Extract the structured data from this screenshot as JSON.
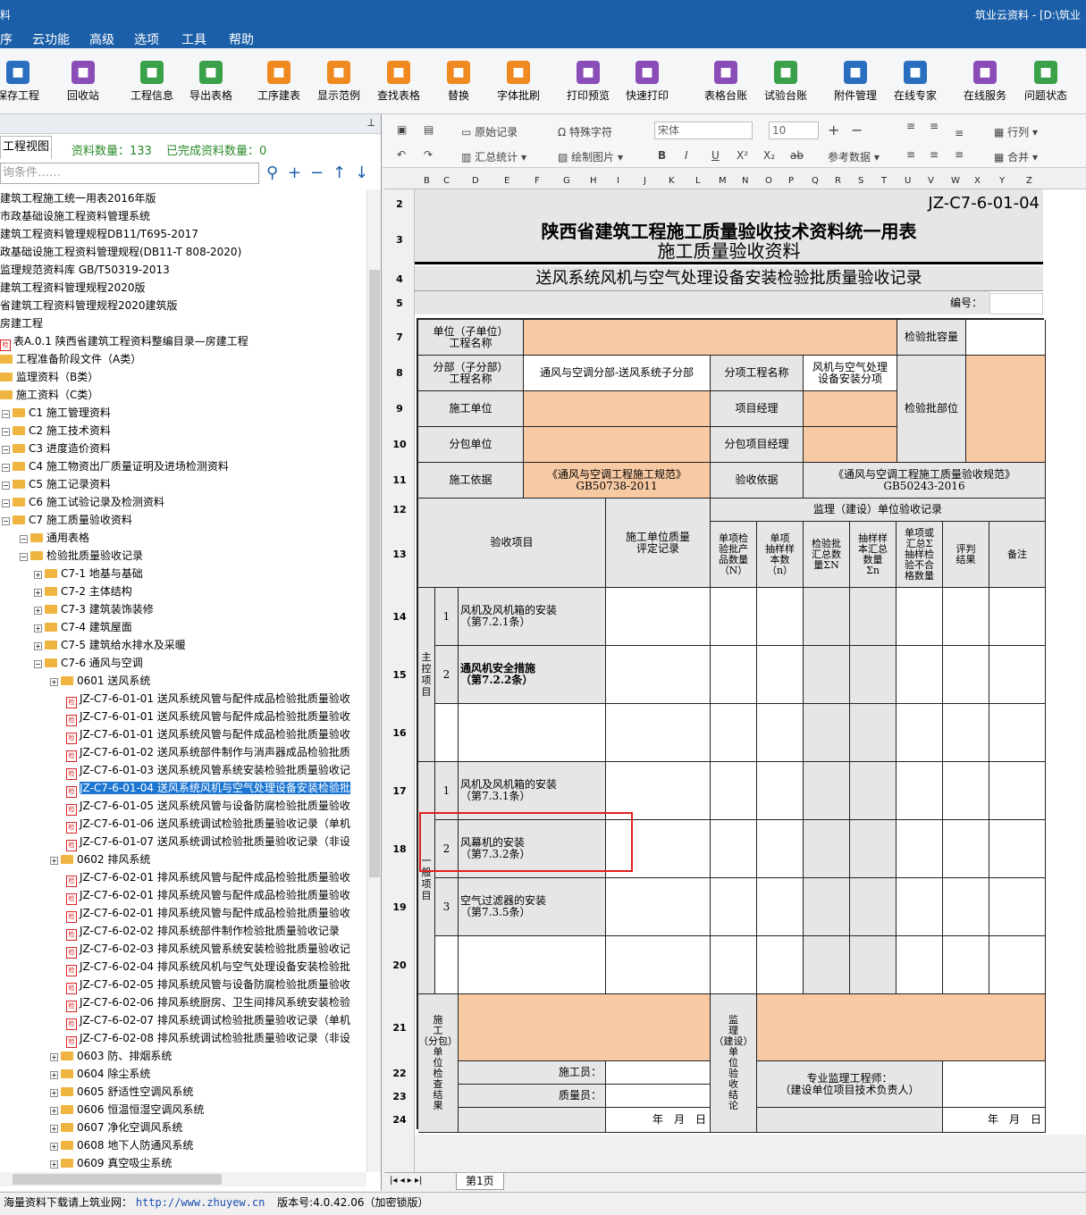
{
  "window": {
    "title_left": "料",
    "title_right": "筑业云资料 - [D:\\筑业"
  },
  "menu": [
    "序",
    "云功能",
    "高级",
    "选项",
    "工具",
    "帮助"
  ],
  "toolbar": [
    {
      "label": "保存工程",
      "icon": "save-icon",
      "color": "#2a6fbf"
    },
    {
      "label": "回收站",
      "icon": "trash-icon",
      "color": "#8a4db8"
    },
    {
      "label": "工程信息",
      "icon": "info-icon",
      "color": "#3aa04a"
    },
    {
      "label": "导出表格",
      "icon": "export-icon",
      "color": "#3aa04a"
    },
    {
      "label": "工序建表",
      "icon": "layers-icon",
      "color": "#f08a20"
    },
    {
      "label": "显示范例",
      "icon": "example-icon",
      "color": "#f08a20"
    },
    {
      "label": "查找表格",
      "icon": "find-icon",
      "color": "#f08a20"
    },
    {
      "label": "替换",
      "icon": "replace-icon",
      "color": "#f08a20"
    },
    {
      "label": "字体批刷",
      "icon": "font-brush-icon",
      "color": "#f08a20"
    },
    {
      "label": "打印预览",
      "icon": "preview-icon",
      "color": "#8a4db8"
    },
    {
      "label": "快速打印",
      "icon": "print-icon",
      "color": "#8a4db8"
    },
    {
      "label": "表格台账",
      "icon": "ledger-icon",
      "color": "#8a4db8"
    },
    {
      "label": "试验台账",
      "icon": "test-ledger-icon",
      "color": "#3aa04a"
    },
    {
      "label": "附件管理",
      "icon": "attachment-icon",
      "color": "#2a6fbf"
    },
    {
      "label": "在线专家",
      "icon": "expert-icon",
      "color": "#2a6fbf"
    },
    {
      "label": "在线服务",
      "icon": "service-icon",
      "color": "#8a4db8"
    },
    {
      "label": "问题状态",
      "icon": "question-icon",
      "color": "#3aa04a"
    }
  ],
  "left": {
    "view_tab": "工程视图",
    "count_label": "资料数量：133",
    "done_label": "已完成资料数量：0",
    "search_placeholder": "询条件……"
  },
  "tree": [
    {
      "level": 0,
      "text": "建筑工程施工统一用表2016年版",
      "type": "none"
    },
    {
      "level": 0,
      "text": "市政基础设施工程资料管理系统",
      "type": "none"
    },
    {
      "level": 0,
      "text": "建筑工程资料管理规程DB11/T695-2017",
      "type": "none"
    },
    {
      "level": 0,
      "text": "政基础设施工程资料管理规程(DB11-T 808-2020)",
      "type": "none"
    },
    {
      "level": 0,
      "text": "监理规范资料库 GB/T50319-2013",
      "type": "none"
    },
    {
      "level": 0,
      "text": "建筑工程资料管理规程2020版",
      "type": "none"
    },
    {
      "level": 0,
      "text": "省建筑工程资料管理规程2020建筑版",
      "type": "none"
    },
    {
      "level": 0,
      "text": "房建工程",
      "type": "none"
    },
    {
      "level": 0,
      "text": "表A.0.1 陕西省建筑工程资料整编目录—房建工程",
      "type": "doc"
    },
    {
      "level": 0,
      "text": "工程准备阶段文件（A类）",
      "type": "folder"
    },
    {
      "level": 0,
      "text": "监理资料（B类）",
      "type": "folder"
    },
    {
      "level": 0,
      "text": "施工资料（C类）",
      "type": "folder"
    },
    {
      "level": 1,
      "text": "C1 施工管理资料",
      "type": "folder"
    },
    {
      "level": 1,
      "text": "C2 施工技术资料",
      "type": "folder"
    },
    {
      "level": 1,
      "text": "C3 进度造价资料",
      "type": "folder"
    },
    {
      "level": 1,
      "text": "C4 施工物资出厂质量证明及进场检测资料",
      "type": "folder"
    },
    {
      "level": 1,
      "text": "C5 施工记录资料",
      "type": "folder"
    },
    {
      "level": 1,
      "text": "C6 施工试验记录及检测资料",
      "type": "folder"
    },
    {
      "level": 1,
      "text": "C7 施工质量验收资料",
      "type": "folder"
    },
    {
      "level": 2,
      "text": "通用表格",
      "type": "folder"
    },
    {
      "level": 2,
      "text": "检验批质量验收记录",
      "type": "folder"
    },
    {
      "level": 3,
      "text": "C7-1 地基与基础",
      "type": "folder"
    },
    {
      "level": 3,
      "text": "C7-2 主体结构",
      "type": "folder"
    },
    {
      "level": 3,
      "text": "C7-3 建筑装饰装修",
      "type": "folder"
    },
    {
      "level": 3,
      "text": "C7-4 建筑屋面",
      "type": "folder"
    },
    {
      "level": 3,
      "text": "C7-5 建筑给水排水及采暖",
      "type": "folder"
    },
    {
      "level": 3,
      "text": "C7-6 通风与空调",
      "type": "folder"
    },
    {
      "level": 4,
      "text": "0601 送风系统",
      "type": "folder"
    },
    {
      "level": 5,
      "text": "JZ-C7-6-01-01 送风系统风管与配件成品检验批质量验收",
      "type": "doc"
    },
    {
      "level": 5,
      "text": "JZ-C7-6-01-01 送风系统风管与配件成品检验批质量验收",
      "type": "doc"
    },
    {
      "level": 5,
      "text": "JZ-C7-6-01-01 送风系统风管与配件成品检验批质量验收",
      "type": "doc"
    },
    {
      "level": 5,
      "text": "JZ-C7-6-01-02 送风系统部件制作与消声器成品检验批质",
      "type": "doc"
    },
    {
      "level": 5,
      "text": "JZ-C7-6-01-03 送风系统风管系统安装检验批质量验收记",
      "type": "doc"
    },
    {
      "level": 5,
      "text": "JZ-C7-6-01-04 送风系统风机与空气处理设备安装检验批",
      "type": "doc",
      "selected": true
    },
    {
      "level": 5,
      "text": "JZ-C7-6-01-05 送风系统风管与设备防腐检验批质量验收",
      "type": "doc"
    },
    {
      "level": 5,
      "text": "JZ-C7-6-01-06 送风系统调试检验批质量验收记录（单机",
      "type": "doc"
    },
    {
      "level": 5,
      "text": "JZ-C7-6-01-07 送风系统调试检验批质量验收记录（非设",
      "type": "doc"
    },
    {
      "level": 4,
      "text": "0602 排风系统",
      "type": "folder"
    },
    {
      "level": 5,
      "text": "JZ-C7-6-02-01 排风系统风管与配件成品检验批质量验收",
      "type": "doc"
    },
    {
      "level": 5,
      "text": "JZ-C7-6-02-01 排风系统风管与配件成品检验批质量验收",
      "type": "doc"
    },
    {
      "level": 5,
      "text": "JZ-C7-6-02-01 排风系统风管与配件成品检验批质量验收",
      "type": "doc"
    },
    {
      "level": 5,
      "text": "JZ-C7-6-02-02 排风系统部件制作检验批质量验收记录",
      "type": "doc"
    },
    {
      "level": 5,
      "text": "JZ-C7-6-02-03 排风系统风管系统安装检验批质量验收记",
      "type": "doc"
    },
    {
      "level": 5,
      "text": "JZ-C7-6-02-04 排风系统风机与空气处理设备安装检验批",
      "type": "doc"
    },
    {
      "level": 5,
      "text": "JZ-C7-6-02-05 排风系统风管与设备防腐检验批质量验收",
      "type": "doc"
    },
    {
      "level": 5,
      "text": "JZ-C7-6-02-06 排风系统厨房、卫生间排风系统安装检验",
      "type": "doc"
    },
    {
      "level": 5,
      "text": "JZ-C7-6-02-07 排风系统调试检验批质量验收记录（单机",
      "type": "doc"
    },
    {
      "level": 5,
      "text": "JZ-C7-6-02-08 排风系统调试检验批质量验收记录（非设",
      "type": "doc"
    },
    {
      "level": 4,
      "text": "0603 防、排烟系统",
      "type": "folder"
    },
    {
      "level": 4,
      "text": "0604 除尘系统",
      "type": "folder"
    },
    {
      "level": 4,
      "text": "0605 舒适性空调风系统",
      "type": "folder"
    },
    {
      "level": 4,
      "text": "0606 恒温恒湿空调风系统",
      "type": "folder"
    },
    {
      "level": 4,
      "text": "0607 净化空调风系统",
      "type": "folder"
    },
    {
      "level": 4,
      "text": "0608 地下人防通风系统",
      "type": "folder"
    },
    {
      "level": 4,
      "text": "0609 真空吸尘系统",
      "type": "folder"
    }
  ],
  "rtool": {
    "original": "原始记录",
    "special": "特殊字符",
    "font": "宋体",
    "size": "10",
    "summary": "汇总统计",
    "draw": "绘制图片",
    "ref": "参考数据",
    "row_col": "行列",
    "merge": "合并"
  },
  "columns": [
    "B",
    "C",
    "D",
    "E",
    "F",
    "G",
    "H",
    "I",
    "J",
    "K",
    "L",
    "M",
    "N",
    "O",
    "P",
    "Q",
    "R",
    "S",
    "T",
    "U",
    "V",
    "W",
    "X",
    "Y",
    "Z"
  ],
  "rows": [
    "2",
    "3",
    "4",
    "5",
    "7",
    "8",
    "9",
    "10",
    "11",
    "12",
    "13",
    "14",
    "15",
    "16",
    "17",
    "18",
    "19",
    "20",
    "21",
    "22",
    "23",
    "24"
  ],
  "form": {
    "code": "JZ-C7-6-01-04",
    "title1": "陕西省建筑工程施工质量验收技术资料统一用表",
    "title2": "施工质量验收资料",
    "subtitle": "送风系统风机与空气处理设备安装检验批质量验收记录",
    "number_label": "编号：",
    "unit_name": "单位（子单位）\n工程名称",
    "capacity": "检验批容量",
    "sub_name": "分部（子分部）\n工程名称",
    "sub_value": "通风与空调分部-送风系统子分部",
    "item_name": "分项工程名称",
    "item_value": "风机与空气处理\n设备安装分项",
    "part": "检验批部位",
    "contractor": "施工单位",
    "pm": "项目经理",
    "subcontractor": "分包单位",
    "sub_pm": "分包项目经理",
    "basis": "施工依据",
    "basis_value": "《通风与空调工程施工规范》\nGB50738-2011",
    "accept_basis": "验收依据",
    "accept_value": "《通风与空调工程施工质量验收规范》\nGB50243-2016",
    "supervise_header": "监理（建设）单位验收记录",
    "accept_item": "验收项目",
    "quality_record": "施工单位质量\n评定记录",
    "h_n": "单项检\n验批产\n品数量\n（N）",
    "h_sample": "单项\n抽样样\n本数\n（n）",
    "h_sumN": "检验批\n汇总数\n量ΣN",
    "h_sumn": "抽样样\n本汇总\n数量\nΣn",
    "h_fail": "单项或\n汇总Σ\n抽样检\n验不合\n格数量",
    "h_result": "评判\n结果",
    "h_remark": "备注",
    "main_ctrl": "主\n控\n项\n目",
    "general": "一\n般\n项\n目",
    "items": [
      {
        "no": "1",
        "text": "风机及风机箱的安装\n（第7.2.1条）"
      },
      {
        "no": "2",
        "text": "通风机安全措施\n（第7.2.2条）"
      },
      {
        "no": "1",
        "text": "风机及风机箱的安装\n（第7.3.1条）"
      },
      {
        "no": "2",
        "text": "风幕机的安装\n（第7.3.2条）"
      },
      {
        "no": "3",
        "text": "空气过滤器的安装\n（第7.3.5条）"
      }
    ],
    "check_result": "施\n工\n（分包）\n单\n位\n检\n查\n结\n果",
    "worker": "施工员：",
    "qc": "质量员：",
    "date": "年　月　日",
    "sup_conclusion": "监\n理\n（建设）\n单\n位\n验\n收\n结\n论",
    "sup_engineer": "专业监理工程师：\n（建设单位项目技术负责人）"
  },
  "sheet_tab": "第1页",
  "status": {
    "text": "海量资料下载请上筑业网：",
    "url": "http://www.zhuyew.cn",
    "version": "版本号:4.0.42.06（加密锁版）"
  }
}
